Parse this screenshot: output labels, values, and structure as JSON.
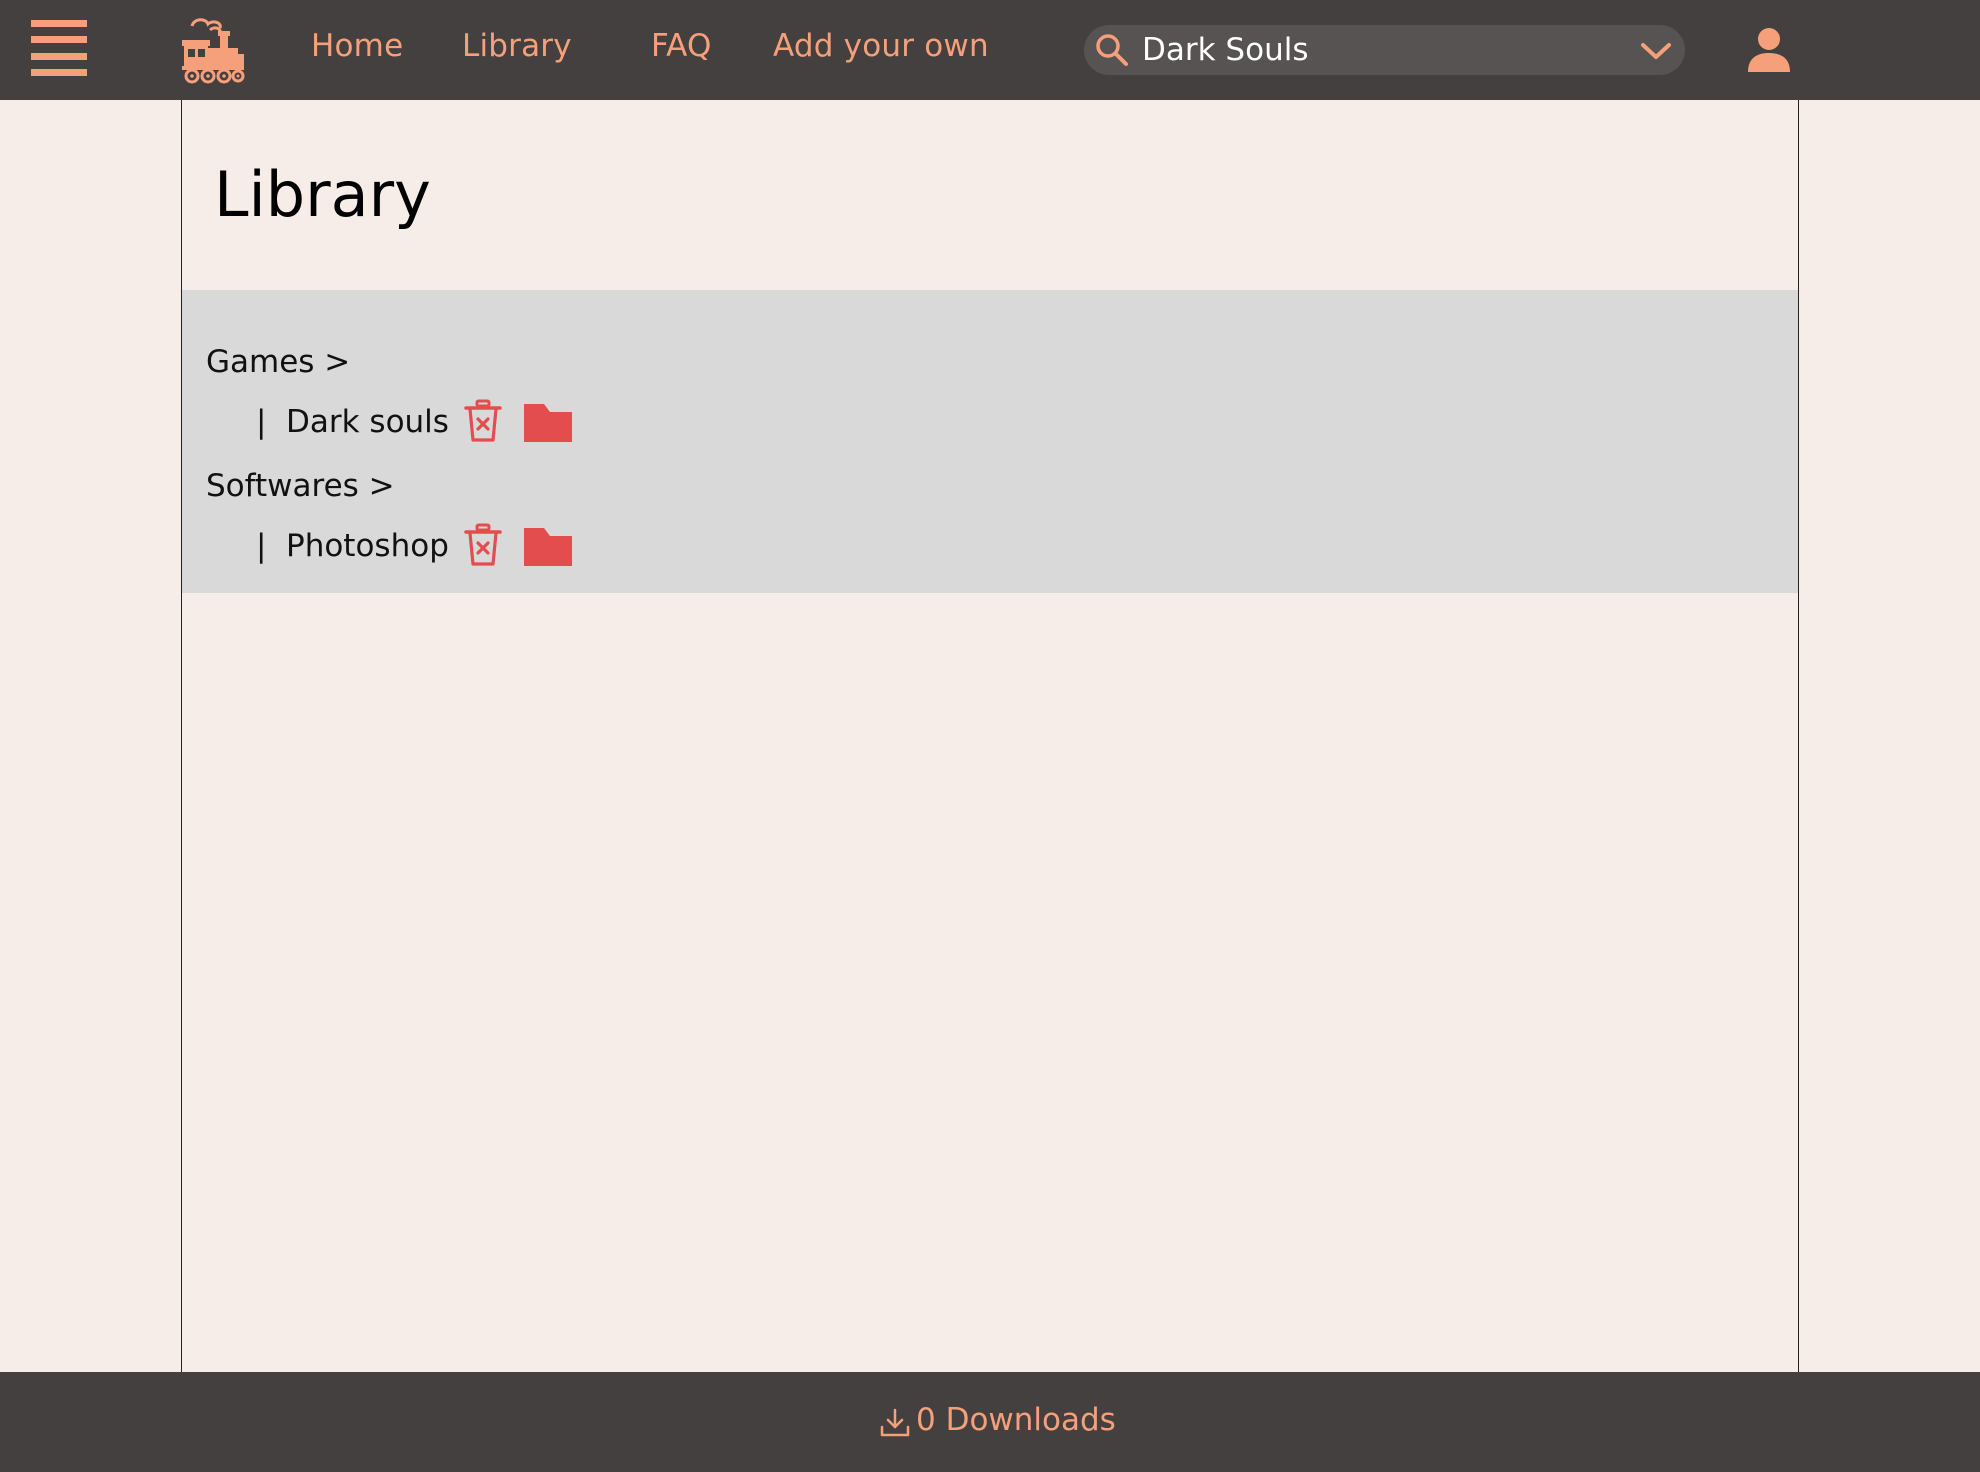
{
  "header": {
    "nav": [
      "Home",
      "Library",
      "FAQ",
      "Add your own"
    ],
    "search": {
      "value": "Dark Souls"
    },
    "icons": {
      "menu": "hamburger-menu-icon",
      "logo": "train-logo-icon",
      "search": "search-icon",
      "dropdown": "chevron-down-icon",
      "user": "user-icon"
    }
  },
  "main": {
    "title": "Library",
    "categories": [
      {
        "label": "Games >",
        "items": [
          {
            "bar": "|",
            "name": "Dark souls"
          }
        ]
      },
      {
        "label": "Softwares >",
        "items": [
          {
            "bar": "|",
            "name": "Photoshop"
          }
        ]
      }
    ]
  },
  "footer": {
    "downloads_label": "0 Downloads",
    "icon": "download-icon"
  },
  "colors": {
    "bar_bg": "#454040",
    "accent": "#f5a07a",
    "page_bg": "#f6ece8",
    "panel_bg": "#d9d9d9",
    "action_red": "#e44d4d"
  }
}
